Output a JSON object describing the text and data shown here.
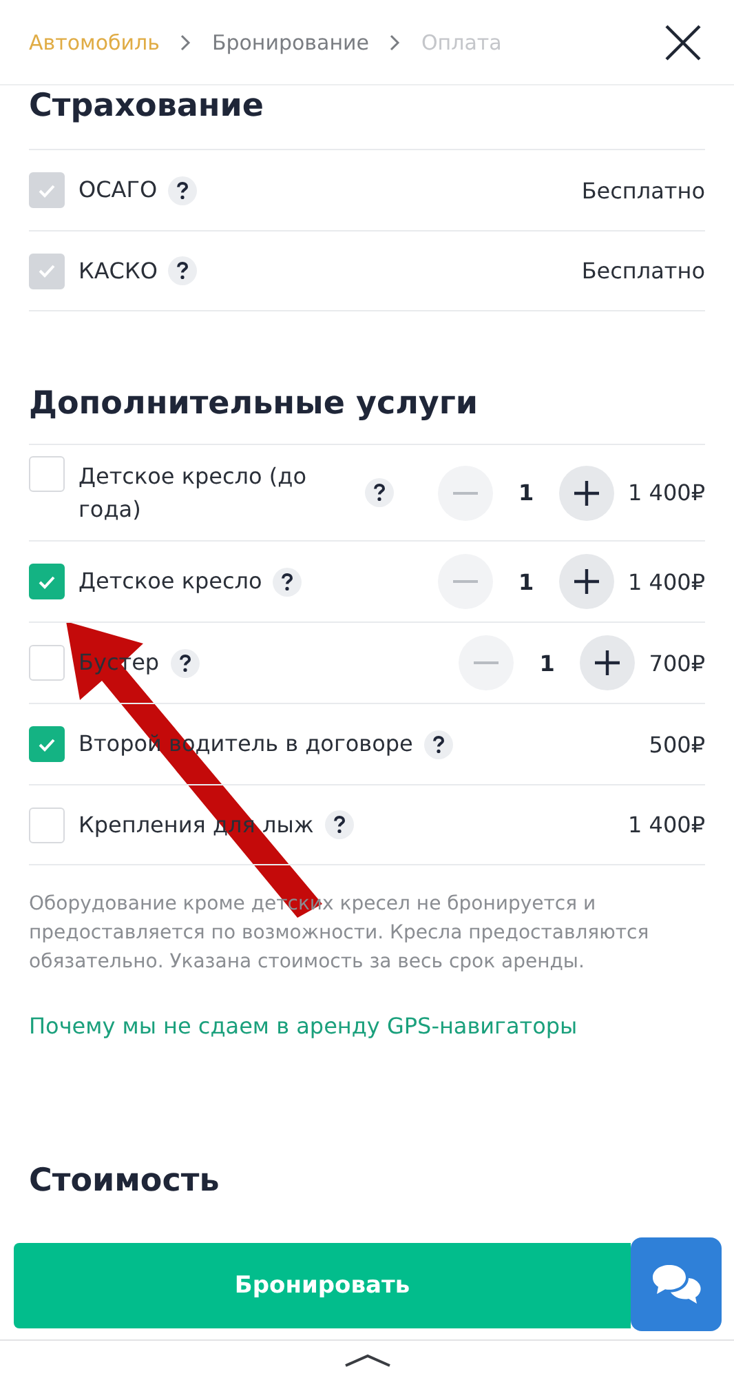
{
  "breadcrumbs": [
    {
      "label": "Автомобиль",
      "selected": true,
      "disabled": false
    },
    {
      "label": "Бронирование",
      "selected": false,
      "disabled": false
    },
    {
      "label": "Оплата",
      "selected": false,
      "disabled": true
    }
  ],
  "insurance": {
    "title": "Страхование",
    "items": [
      {
        "label": "ОСАГО",
        "checked": true,
        "disabled": true,
        "price": "Бесплатно"
      },
      {
        "label": "КАСКО",
        "checked": true,
        "disabled": true,
        "price": "Бесплатно"
      }
    ]
  },
  "extras": {
    "title": "Дополнительные услуги",
    "items": [
      {
        "label": "Детское кресло (до года)",
        "checked": false,
        "quantity": "1",
        "price": "1 400₽"
      },
      {
        "label": "Детское кресло",
        "checked": true,
        "quantity": "1",
        "price": "1 400₽"
      },
      {
        "label": "Бустер",
        "checked": false,
        "quantity": "1",
        "price": "700₽"
      },
      {
        "label": "Второй водитель в договоре",
        "checked": true,
        "price": "500₽"
      },
      {
        "label": "Крепления для лыж",
        "checked": false,
        "price": "1 400₽"
      }
    ]
  },
  "note": "Оборудование кроме детских кресел не бронируется и предоставляется по возможности. Кресла предоставляются обязательно. Указана стоимость за весь срок аренды.",
  "link": "Почему мы не сдаем в аренду GPS-навигаторы",
  "cost_title": "Стоимость",
  "book_button": "Бронировать"
}
